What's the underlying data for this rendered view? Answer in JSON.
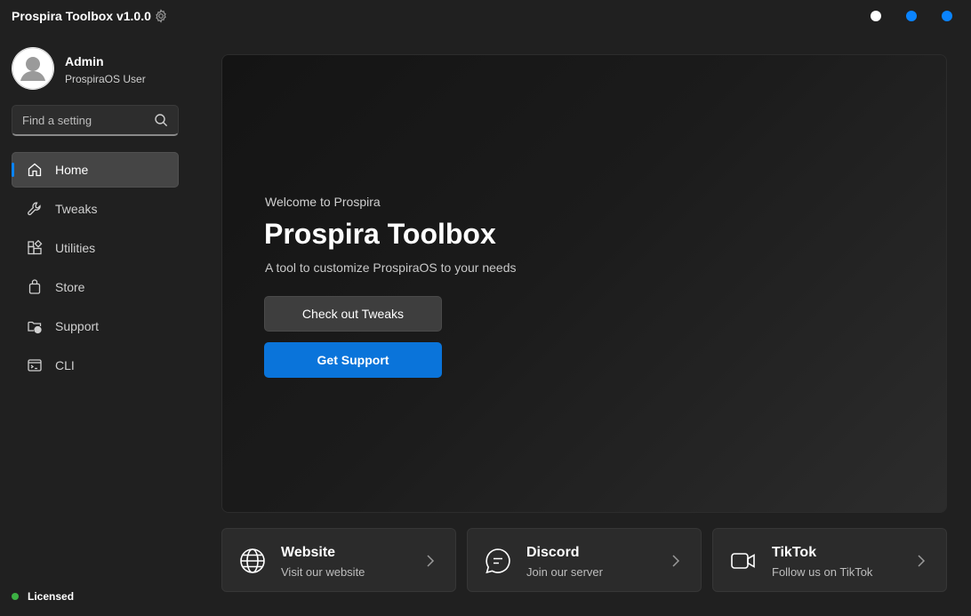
{
  "app": {
    "title": "Prospira Toolbox v1.0.0"
  },
  "user": {
    "name": "Admin",
    "subtitle": "ProspiraOS User"
  },
  "search": {
    "placeholder": "Find a setting"
  },
  "nav": {
    "items": [
      {
        "label": "Home",
        "icon": "home-icon",
        "active": true
      },
      {
        "label": "Tweaks",
        "icon": "wrench-icon"
      },
      {
        "label": "Utilities",
        "icon": "apps-icon"
      },
      {
        "label": "Store",
        "icon": "store-icon"
      },
      {
        "label": "Support",
        "icon": "folder-support-icon"
      },
      {
        "label": "CLI",
        "icon": "terminal-icon"
      }
    ]
  },
  "status": {
    "label": "Licensed",
    "color": "#3cb043"
  },
  "hero": {
    "welcome": "Welcome to Prospira",
    "title": "Prospira Toolbox",
    "subtitle": "A tool to customize ProspiraOS to your needs",
    "primary_button": "Check out Tweaks",
    "secondary_button": "Get Support"
  },
  "cards": [
    {
      "title": "Website",
      "subtitle": "Visit our website",
      "icon": "globe-icon"
    },
    {
      "title": "Discord",
      "subtitle": "Join our server",
      "icon": "chat-icon"
    },
    {
      "title": "TikTok",
      "subtitle": "Follow us on TikTok",
      "icon": "video-icon"
    }
  ],
  "colors": {
    "accent": "#0a74da",
    "background": "#202020",
    "window_dot_white": "#ffffff",
    "window_dot_blue": "#0a84ff"
  }
}
